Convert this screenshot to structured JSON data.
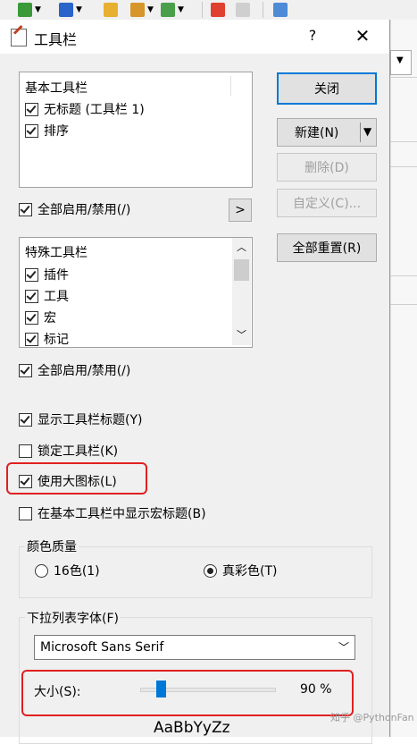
{
  "dialog": {
    "title": "工具栏",
    "help": "?",
    "close_glyph": "✕"
  },
  "basic_list": {
    "header": "基本工具栏",
    "items": [
      {
        "label": "无标题 (工具栏 1)",
        "checked": true
      },
      {
        "label": "排序",
        "checked": true
      }
    ]
  },
  "enable_all_1": "全部启用/禁用(/)",
  "expand_btn": ">",
  "special_list": {
    "header": "特殊工具栏",
    "items": [
      {
        "label": "插件",
        "checked": true
      },
      {
        "label": "工具",
        "checked": true
      },
      {
        "label": "宏",
        "checked": true
      },
      {
        "label": "标记",
        "checked": true
      }
    ]
  },
  "enable_all_2": "全部启用/禁用(/)",
  "options": {
    "show_titles": "显示工具栏标题(Y)",
    "lock": "锁定工具栏(K)",
    "large_icons": "使用大图标(L)",
    "macro_titles": "在基本工具栏中显示宏标题(B)"
  },
  "buttons": {
    "close": "关闭",
    "new": "新建(N)",
    "delete": "删除(D)",
    "customize": "自定义(C)...",
    "reset_all": "全部重置(R)"
  },
  "color_quality": {
    "label": "颜色质量",
    "opt16": "16色(1)",
    "true_color": "真彩色(T)",
    "selected": "true_color"
  },
  "dropdown_font": {
    "label": "下拉列表字体(F)",
    "value": "Microsoft Sans Serif"
  },
  "size": {
    "label": "大小(S):",
    "value_text": "90 %",
    "value": 0.15
  },
  "preview": "AaBbYyZz",
  "watermark": "知乎 @PythonFan",
  "colors": {
    "accent": "#0078d7",
    "highlight": "#e02020"
  }
}
